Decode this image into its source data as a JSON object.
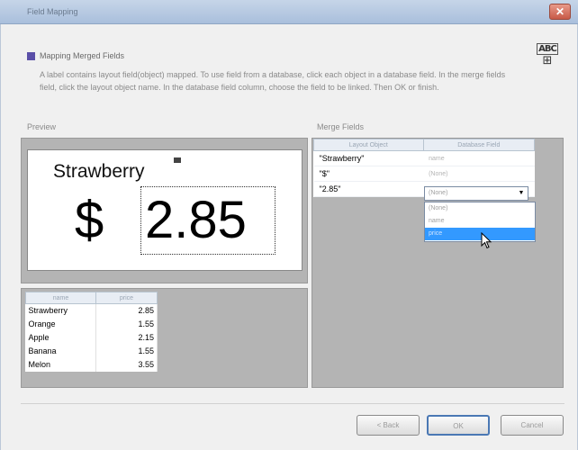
{
  "window": {
    "title": "Field Mapping",
    "close_label": "✕"
  },
  "header": {
    "title": "Mapping Merged Fields",
    "description": "A label contains layout field(object) mapped. To use field from a database, click each object in a database field. In the merge fields field, click the layout object name. In the database field column, choose the field to be linked. Then OK or finish."
  },
  "preview": {
    "section_label": "Preview",
    "label_name": "Strawberry",
    "currency": "$",
    "price": "2.85"
  },
  "data_table": {
    "columns": [
      "name",
      "price"
    ],
    "rows": [
      [
        "Strawberry",
        "2.85"
      ],
      [
        "Orange",
        "1.55"
      ],
      [
        "Apple",
        "2.15"
      ],
      [
        "Banana",
        "1.55"
      ],
      [
        "Melon",
        "3.55"
      ]
    ]
  },
  "merge_fields": {
    "section_label": "Merge Fields",
    "columns": [
      "Layout Object",
      "Database Field"
    ],
    "rows": [
      {
        "object": "\"Strawberry\"",
        "field": "name"
      },
      {
        "object": "\"$\"",
        "field": "(None)"
      },
      {
        "object": "\"2.85\"",
        "field": ""
      }
    ],
    "combo_value": "(None)",
    "dropdown_options": [
      "(None)",
      "name",
      "price"
    ],
    "dropdown_selected_index": 2
  },
  "buttons": {
    "back": "< Back",
    "ok": "OK",
    "cancel": "Cancel"
  },
  "icons": {
    "logo": "abc-merge-icon",
    "cursor": "mouse-pointer-icon"
  }
}
